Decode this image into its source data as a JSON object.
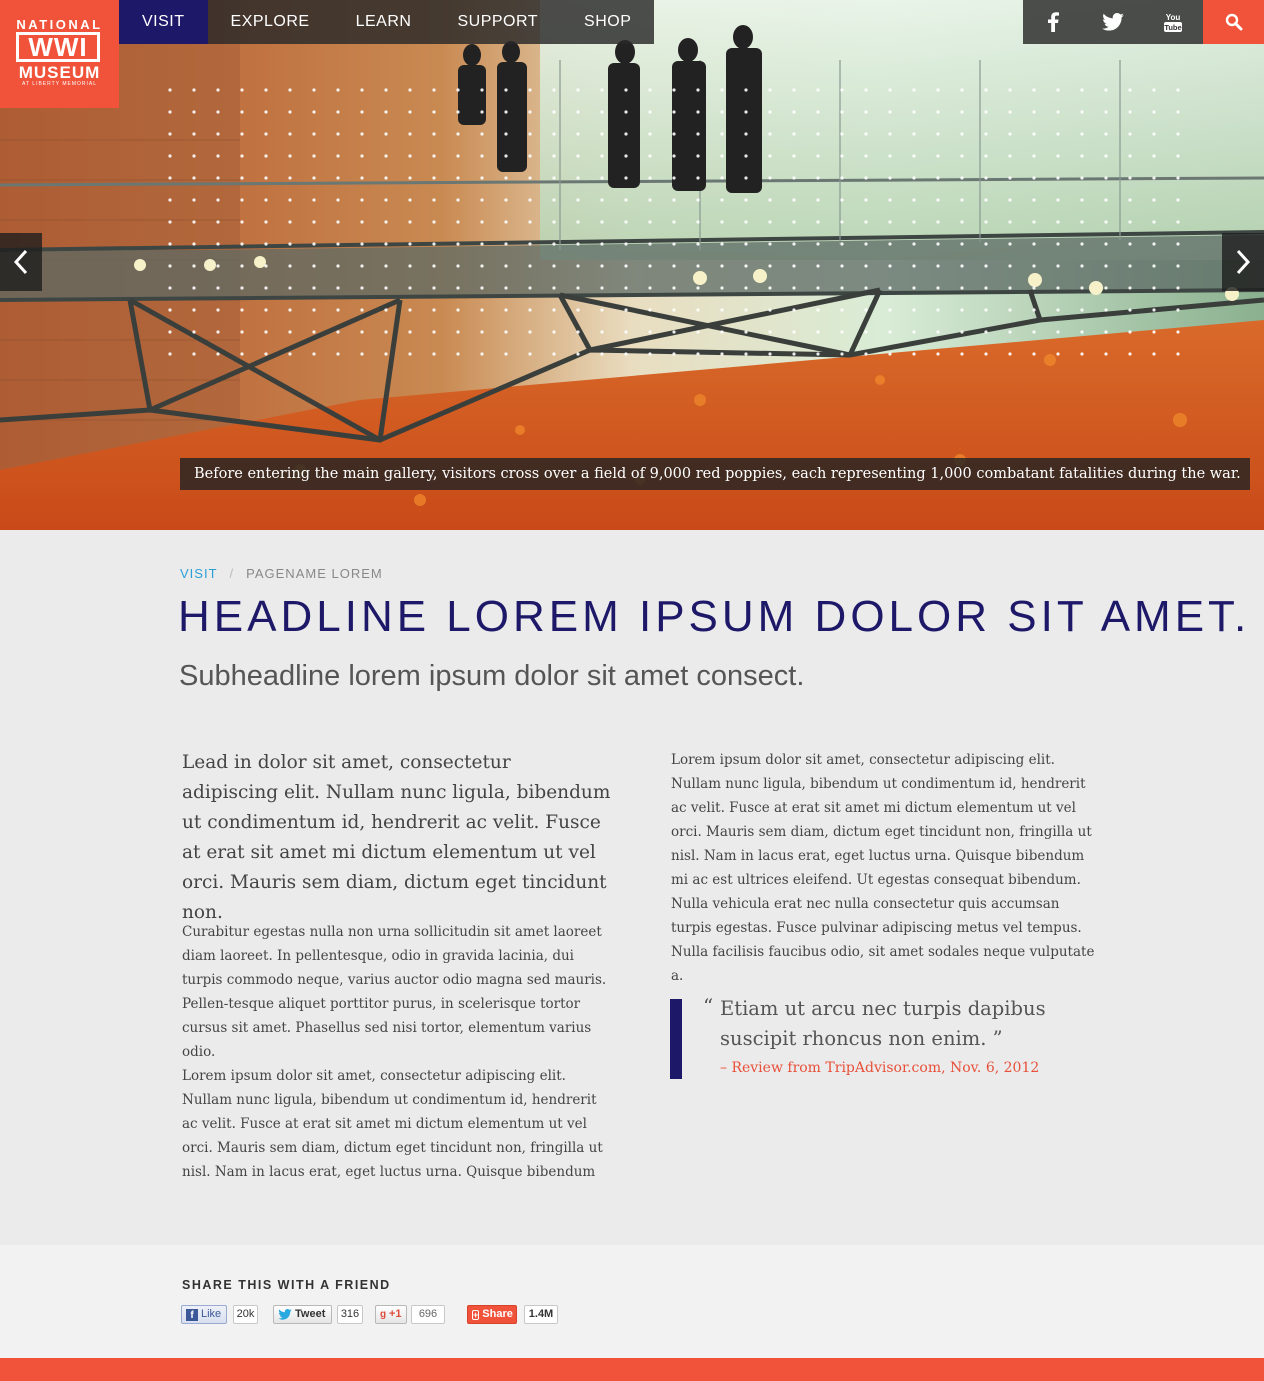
{
  "logo": {
    "line1": "NATIONAL",
    "line2": "WWI",
    "line3": "MUSEUM",
    "line4": "AT LIBERTY MEMORIAL"
  },
  "nav": {
    "items": [
      {
        "label": "VISIT"
      },
      {
        "label": "EXPLORE"
      },
      {
        "label": "LEARN"
      },
      {
        "label": "SUPPORT"
      },
      {
        "label": "SHOP"
      }
    ]
  },
  "social": {
    "icons": [
      "facebook-icon",
      "twitter-icon",
      "youtube-icon"
    ],
    "youtube_label": "You Tube"
  },
  "hero": {
    "caption": "Before entering the main gallery, visitors cross over a field of 9,000 red poppies, each representing 1,000 combatant fatalities during the war."
  },
  "breadcrumb": {
    "crumb1": "VISIT",
    "separator": "/",
    "crumb2": "PAGENAME LOREM"
  },
  "headline": "HEADLINE LOREM IPSUM DOLOR SIT AMET.",
  "subheadline": "Subheadline lorem ipsum dolor sit amet consect.",
  "lead": "Lead in dolor sit amet, consectetur adipiscing elit. Nullam nunc ligula, bibendum ut condimentum id, hendrerit ac velit. Fusce at erat sit amet mi dictum elementum ut vel orci. Mauris sem diam, dictum eget tincidunt non.",
  "paragraph1": "Curabitur egestas nulla non urna sollicitudin sit amet laoreet diam laoreet. In pellentesque, odio in gravida lacinia, dui turpis commodo neque, varius auctor odio magna sed mauris. Pellen-tesque aliquet porttitor purus, in scelerisque tortor cursus sit amet. Phasellus sed nisi tortor, elementum varius odio.",
  "paragraph2": "Lorem ipsum dolor sit amet, consectetur adipiscing elit. Nullam nunc ligula, bibendum ut condimentum id, hendrerit ac velit. Fusce at erat sit amet mi dictum elementum ut vel orci. Mauris sem diam, dictum eget tincidunt non, fringilla ut nisl. Nam in lacus erat, eget luctus urna. Quisque bibendum mi ac est ultrices",
  "paragraph3": "Lorem ipsum dolor sit amet, consectetur adipiscing elit. Nullam nunc ligula, bibendum ut condimentum id, hendrerit ac velit. Fusce at erat sit amet mi dictum elementum ut vel orci. Mauris sem diam, dictum eget tincidunt non, fringilla ut nisl. Nam in lacus erat, eget luctus urna. Quisque bibendum mi ac est ultrices eleifend. Ut egestas consequat bibendum. Nulla vehicula erat nec nulla consectetur quis accumsan turpis egestas. Fusce pulvinar adipiscing metus vel tempus. Nulla facilisis faucibus odio, sit amet sodales neque vulputate a.",
  "quote": {
    "open_mark": "“",
    "text": "Etiam ut arcu nec turpis dapibus suscipit rhoncus non enim. ”",
    "cite": "– Review from TripAdvisor.com, Nov. 6, 2012"
  },
  "share": {
    "title": "SHARE THIS WITH A FRIEND",
    "facebook_label": "Like",
    "facebook_count": "20k",
    "twitter_label": "Tweet",
    "twitter_count": "316",
    "gplus_label": "+1",
    "gplus_count": "696",
    "share_label": "Share",
    "share_count": "1.4M"
  },
  "colors": {
    "brand_red": "#f0533a",
    "navy": "#1e1869",
    "link_blue": "#2a9fd6"
  }
}
